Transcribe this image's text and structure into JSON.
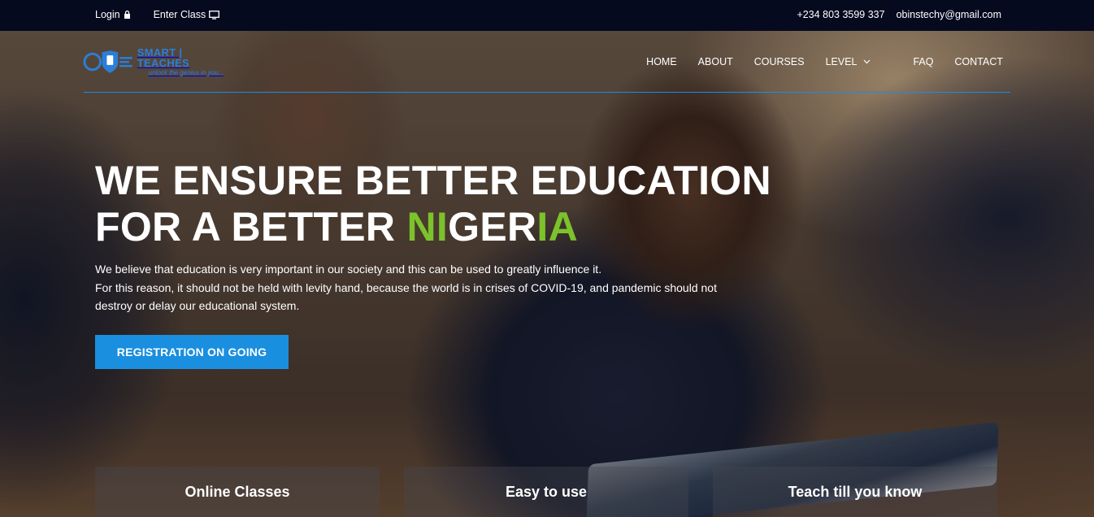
{
  "topbar": {
    "login_label": "Login",
    "enter_class_label": "Enter Class",
    "phone": "+234 803 3599 337",
    "email": "obinstechy@gmail.com"
  },
  "logo": {
    "name": "SMART | TEACHES",
    "tagline": "unlock the genius in you..."
  },
  "nav": {
    "items": [
      {
        "label": "HOME"
      },
      {
        "label": "ABOUT"
      },
      {
        "label": "COURSES"
      },
      {
        "label": "LEVEL"
      },
      {
        "label": "FAQ"
      },
      {
        "label": "CONTACT"
      }
    ]
  },
  "hero": {
    "line1": "WE ENSURE BETTER EDUCATION",
    "line2_a": "FOR A BETTER ",
    "line2_b": "NI",
    "line2_c": "GER",
    "line2_d": "IA",
    "desc1": "We believe that education is very important in our society and this can be used to greatly influence it.",
    "desc2": "For this reason, it should not be held with levity hand, because the world is in crises of COVID-19, and pandemic should not destroy or delay our educational system.",
    "cta_label": "REGISTRATION ON GOING"
  },
  "features": [
    {
      "title": "Online Classes"
    },
    {
      "title": "Easy to use"
    },
    {
      "title": "Teach till you know"
    }
  ],
  "colors": {
    "accent": "#1a8fe0",
    "highlight_green": "#7cc22b",
    "topbar_bg": "#060a1f"
  }
}
